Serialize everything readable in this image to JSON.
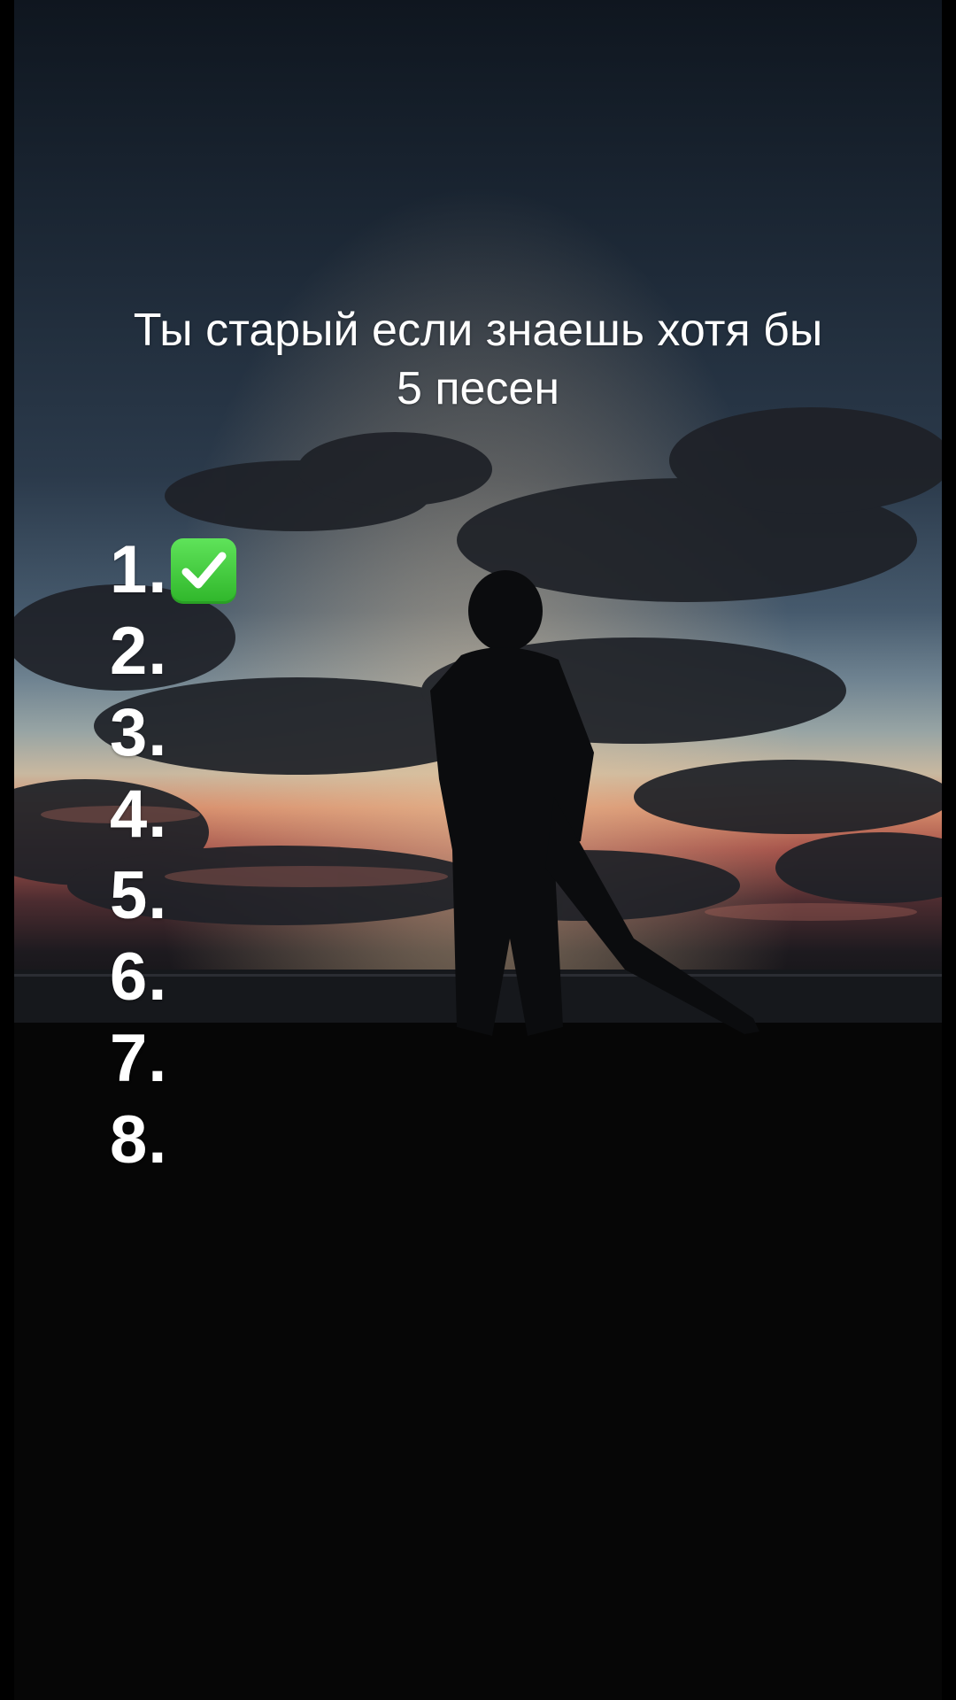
{
  "caption": {
    "line1": "Ты старый если знаешь хотя бы",
    "line2": "5 песен"
  },
  "list": [
    {
      "label": "1.",
      "checked": true
    },
    {
      "label": "2.",
      "checked": false
    },
    {
      "label": "3.",
      "checked": false
    },
    {
      "label": "4.",
      "checked": false
    },
    {
      "label": "5.",
      "checked": false
    },
    {
      "label": "6.",
      "checked": false
    },
    {
      "label": "7.",
      "checked": false
    },
    {
      "label": "8.",
      "checked": false
    }
  ],
  "icons": {
    "check": "check-mark-button-icon"
  },
  "colors": {
    "text": "#ffffff",
    "check_green": "#3fc83a"
  }
}
